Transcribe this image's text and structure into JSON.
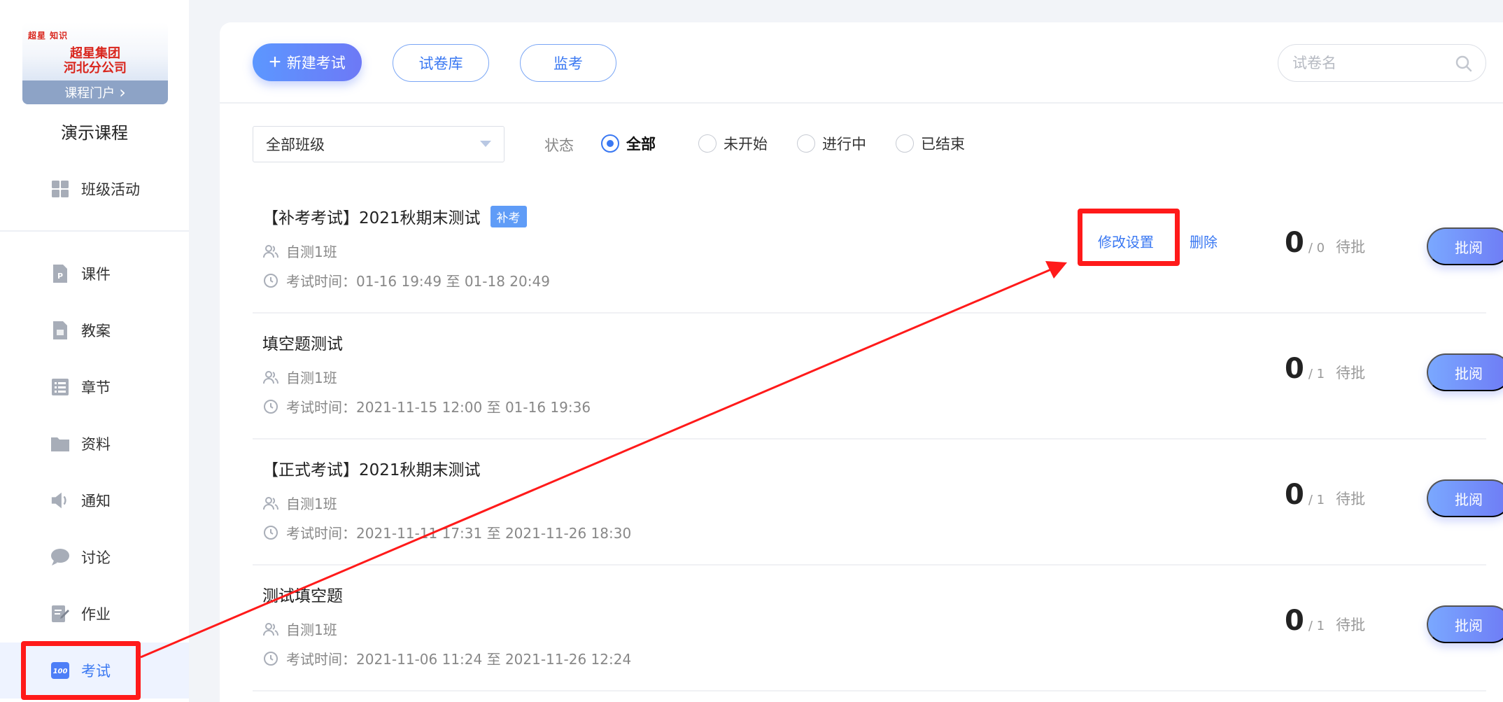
{
  "sidebar": {
    "logo": {
      "mark": "超星 知识",
      "line1": "超星集团",
      "line2": "河北分公司",
      "portal_label": "课程门户",
      "portal_chevron": "›"
    },
    "course_title": "演示课程",
    "items": [
      {
        "label": "班级活动",
        "icon": "grid-icon"
      },
      {
        "label": "课件",
        "icon": "ppt-file-icon"
      },
      {
        "label": "教案",
        "icon": "lesson-plan-icon"
      },
      {
        "label": "章节",
        "icon": "list-icon"
      },
      {
        "label": "资料",
        "icon": "folder-icon"
      },
      {
        "label": "通知",
        "icon": "speaker-icon"
      },
      {
        "label": "讨论",
        "icon": "chat-bubble-icon"
      },
      {
        "label": "作业",
        "icon": "edit-document-icon"
      },
      {
        "label": "考试",
        "icon": "exam-100-icon",
        "active": true
      }
    ]
  },
  "toolbar": {
    "new_exam_label": "新建考试",
    "bank_label": "试卷库",
    "proctor_label": "监考",
    "search_placeholder": "试卷名"
  },
  "filters": {
    "class_select_value": "全部班级",
    "status_label": "状态",
    "statuses": [
      {
        "label": "全部",
        "checked": true
      },
      {
        "label": "未开始",
        "checked": false
      },
      {
        "label": "进行中",
        "checked": false
      },
      {
        "label": "已结束",
        "checked": false
      }
    ]
  },
  "exams": [
    {
      "title": "【补考考试】2021秋期末测试",
      "tag": "补考",
      "class_name": "自测1班",
      "time_label": "考试时间：",
      "time_range": "01-16 19:49 至 01-18 20:49",
      "edit_label": "修改设置",
      "delete_label": "删除",
      "submitted": "0",
      "total": "/ 0",
      "pending_label": "待批",
      "review_label": "批阅"
    },
    {
      "title": "填空题测试",
      "class_name": "自测1班",
      "time_label": "考试时间：",
      "time_range": "2021-11-15 12:00 至 01-16 19:36",
      "submitted": "0",
      "total": "/ 1",
      "pending_label": "待批",
      "review_label": "批阅"
    },
    {
      "title": "【正式考试】2021秋期末测试",
      "class_name": "自测1班",
      "time_label": "考试时间：",
      "time_range": "2021-11-11 17:31 至 2021-11-26 18:30",
      "submitted": "0",
      "total": "/ 1",
      "pending_label": "待批",
      "review_label": "批阅"
    },
    {
      "title": "测试填空题",
      "class_name": "自测1班",
      "time_label": "考试时间：",
      "time_range": "2021-11-06 11:24 至 2021-11-26 12:24",
      "submitted": "0",
      "total": "/ 1",
      "pending_label": "待批",
      "review_label": "批阅"
    }
  ],
  "colors": {
    "accent": "#3a78f2",
    "annotation": "#ff1a1a",
    "tag": "#5f9cf7"
  }
}
